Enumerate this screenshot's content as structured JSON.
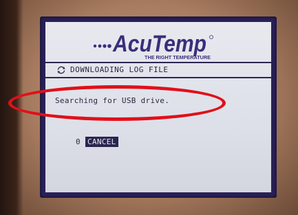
{
  "logo": {
    "brand": "AcuTemp",
    "tagline": "THE RIGHT TEMPERATURE"
  },
  "status": {
    "title": "DOWNLOADING LOG FILE",
    "icon": "refresh-icon"
  },
  "message": "Searching for USB drive.",
  "cancel": {
    "key": "0",
    "label": "CANCEL"
  },
  "colors": {
    "screen": "#e8e9ef",
    "frame": "#2a2158",
    "text": "#2b2540",
    "annotation": "#e0101a"
  }
}
